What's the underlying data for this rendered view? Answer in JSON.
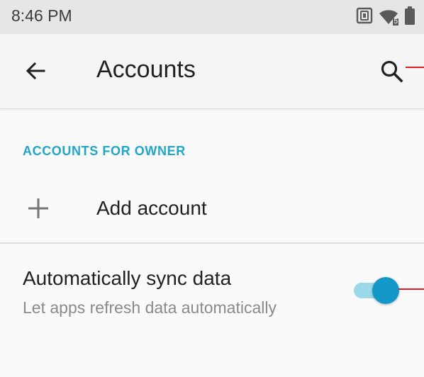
{
  "status_bar": {
    "time": "8:46 PM",
    "icons": [
      "nfc-icon",
      "wifi-icon",
      "battery-icon"
    ],
    "wifi_band": "5"
  },
  "app_bar": {
    "title": "Accounts",
    "back_icon": "arrow-back-icon",
    "search_icon": "search-icon"
  },
  "section": {
    "header": "ACCOUNTS FOR OWNER"
  },
  "add_account": {
    "label": "Add account",
    "icon": "plus-icon"
  },
  "sync": {
    "title": "Automatically sync data",
    "subtitle": "Let apps refresh data automatically",
    "enabled": true
  },
  "colors": {
    "accent": "#20a6c9",
    "toggle_thumb": "#1498c9",
    "toggle_track": "#9ad9ea",
    "annotation_line": "#e02020",
    "status_bar_bg": "#e6e6e6"
  }
}
